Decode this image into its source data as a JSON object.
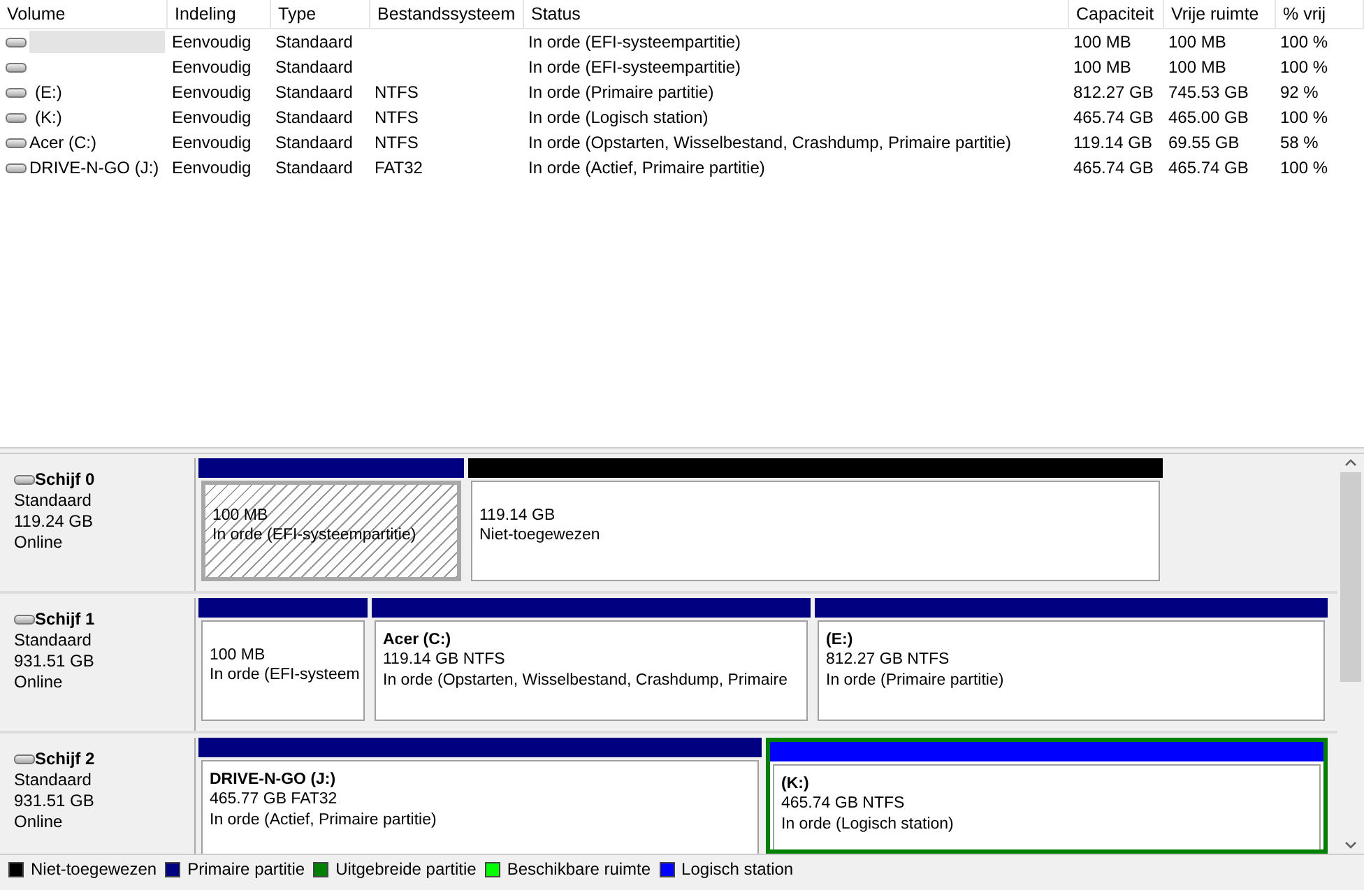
{
  "volume_list": {
    "columns": [
      "Volume",
      "Indeling",
      "Type",
      "Bestandssysteem",
      "Status",
      "Capaciteit",
      "Vrije ruimte",
      "% vrij"
    ],
    "rows": [
      {
        "selected": true,
        "cells": [
          "",
          "Eenvoudig",
          "Standaard",
          "",
          "In orde (EFI-systeempartitie)",
          "100 MB",
          "100 MB",
          "100 %"
        ]
      },
      {
        "selected": false,
        "cells": [
          "",
          "Eenvoudig",
          "Standaard",
          "",
          "In orde (EFI-systeempartitie)",
          "100 MB",
          "100 MB",
          "100 %"
        ]
      },
      {
        "selected": false,
        "cells": [
          "(E:)",
          "Eenvoudig",
          "Standaard",
          "NTFS",
          "In orde (Primaire partitie)",
          "812.27 GB",
          "745.53 GB",
          "92 %"
        ]
      },
      {
        "selected": false,
        "cells": [
          "(K:)",
          "Eenvoudig",
          "Standaard",
          "NTFS",
          "In orde (Logisch station)",
          "465.74 GB",
          "465.00 GB",
          "100 %"
        ]
      },
      {
        "selected": false,
        "cells": [
          "Acer (C:)",
          "Eenvoudig",
          "Standaard",
          "NTFS",
          "In orde (Opstarten, Wisselbestand, Crashdump, Primaire partitie)",
          "119.14 GB",
          "69.55 GB",
          "58 %"
        ]
      },
      {
        "selected": false,
        "cells": [
          "DRIVE-N-GO (J:)",
          "Eenvoudig",
          "Standaard",
          "FAT32",
          "In orde (Actief, Primaire partitie)",
          "465.74 GB",
          "465.74 GB",
          "100 %"
        ]
      }
    ]
  },
  "disks": [
    {
      "name": "Schijf 0",
      "type": "Standaard",
      "size": "119.24 GB",
      "state": "Online",
      "partitions": [
        {
          "kind": "primary",
          "selected": true,
          "size": "100 MB",
          "status": "In orde (EFI-systeempartitie)"
        },
        {
          "kind": "unallocated",
          "selected": false,
          "size": "119.14 GB",
          "status": "Niet-toegewezen"
        }
      ]
    },
    {
      "name": "Schijf 1",
      "type": "Standaard",
      "size": "931.51 GB",
      "state": "Online",
      "partitions": [
        {
          "kind": "primary",
          "selected": false,
          "size": "100 MB",
          "status": "In orde (EFI-systeem"
        },
        {
          "kind": "primary",
          "selected": false,
          "label": "Acer  (C:)",
          "size": "119.14 GB NTFS",
          "status": "In orde (Opstarten, Wisselbestand, Crashdump, Primaire"
        },
        {
          "kind": "primary",
          "selected": false,
          "label": "(E:)",
          "size": "812.27 GB NTFS",
          "status": "In orde (Primaire partitie)"
        }
      ]
    },
    {
      "name": "Schijf 2",
      "type": "Standaard",
      "size": "931.51 GB",
      "state": "Online",
      "partitions": [
        {
          "kind": "primary",
          "selected": false,
          "label": "DRIVE-N-GO  (J:)",
          "size": "465.77 GB FAT32",
          "status": "In orde (Actief, Primaire partitie)"
        },
        {
          "kind": "extended",
          "children": [
            {
              "kind": "logical",
              "selected": false,
              "label": "(K:)",
              "size": "465.74 GB NTFS",
              "status": "In orde (Logisch station)"
            }
          ]
        }
      ]
    }
  ],
  "legend": [
    {
      "kind": "unallocated",
      "label": "Niet-toegewezen",
      "color": "#000000"
    },
    {
      "kind": "primary",
      "label": "Primaire partitie",
      "color": "#000080"
    },
    {
      "kind": "extended",
      "label": "Uitgebreide partitie",
      "color": "#008000"
    },
    {
      "kind": "free",
      "label": "Beschikbare ruimte",
      "color": "#00ff00"
    },
    {
      "kind": "logical",
      "label": "Logisch station",
      "color": "#0000ff"
    }
  ]
}
